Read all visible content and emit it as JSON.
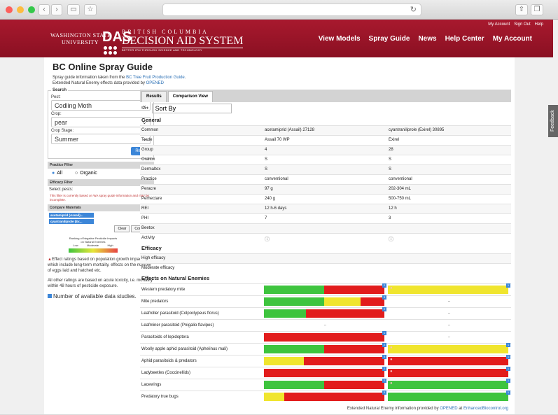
{
  "browser": {
    "nav_icons": [
      "chevron-left-icon",
      "chevron-right-icon",
      "sidebar-icon",
      "star-icon"
    ]
  },
  "header": {
    "wsu_line1": "WASHINGTON STATE",
    "wsu_line2": "UNIVERSITY",
    "das": "DAS",
    "brand_line1": "BRITISH COLUMBIA",
    "brand_line2": "DECISION AID SYSTEM",
    "brand_line3": "BETTER IPM THROUGH SCIENCE AND TECHNOLOGY",
    "top_links": [
      "My Account",
      "Sign Out",
      "Help"
    ],
    "nav": [
      "View Models",
      "Spray Guide",
      "News",
      "Help Center",
      "My Account"
    ]
  },
  "feedback": "Feedback",
  "page": {
    "title": "BC Online Spray Guide",
    "intro_line1_prefix": "Spray guide information taken from the ",
    "intro_line1_link": "BC Tree Fruit Production Guide",
    "intro_line2_prefix": "Extended Natural Enemy effects data provided by ",
    "intro_line2_link": "OPENED"
  },
  "sidebar": {
    "search_legend": "Search",
    "pest_label": "Pest:",
    "pest_value": "Codling Moth",
    "crop_label": "Crop:",
    "crop_value": "pear",
    "stage_label": "Crop Stage:",
    "stage_value": "Summer",
    "reset": "Reset",
    "practice_header": "Practice Filter",
    "practice_all": "All",
    "practice_organic": "Organic",
    "efficacy_header": "Efficacy Filter",
    "select_pests": "Select pests:",
    "efficacy_note": "This filter is currently based on WA spray guide information and may be incomplete.",
    "compare_header": "Compare Materials",
    "materials": [
      "acetamiprid (Assail)...",
      "cyantraniliprole (Ex..."
    ],
    "clear": "Clear",
    "compare": "Compare",
    "legend_title": "Ranking of Negative Pesticide Impacts on Natural Enemies",
    "legend_low": "Low",
    "legend_moderate": "Moderate",
    "legend_high": "High",
    "note1": "Effect ratings based on population growth impacts, which include long-term mortality, effects on the number of eggs laid and hatched etc.",
    "note2": "All other ratings are based on acute toxicity, i.e. mortality within 48 hours of pesticide exposure.",
    "note3": "Number of available data studies."
  },
  "content": {
    "tabs": [
      "Results",
      "Comparison View"
    ],
    "sort_label": "Sort:",
    "sort_value": "Sort By",
    "general_title": "General",
    "general_rows": [
      [
        "Common",
        "acetamiprid (Assail) 27128",
        "cyantraniliprole (Exirel) 30895"
      ],
      [
        "Trade",
        "Assail 70 WP",
        "Exirel"
      ],
      [
        "Group",
        "4",
        "28"
      ],
      [
        "Oraltox",
        "S",
        "S"
      ],
      [
        "Dermaltox",
        "S",
        "S"
      ],
      [
        "Practice",
        "conventional",
        "conventional"
      ],
      [
        "Peracre",
        "97 g",
        "202-304 mL"
      ],
      [
        "Perhectare",
        "240 g",
        "500-750 mL"
      ],
      [
        "REI",
        "12 h-6 days",
        "12 h"
      ],
      [
        "PHI",
        "7",
        "3"
      ],
      [
        "Beetox",
        "",
        ""
      ],
      [
        "Activity",
        "",
        ""
      ]
    ],
    "efficacy_title": "Efficacy",
    "efficacy_rows": [
      "High efficacy",
      "Moderate efficacy"
    ],
    "ne_title": "Effects on Natural Enemies",
    "ne_rows": [
      {
        "label": "Western predatory mite",
        "a": {
          "green": 0.5,
          "yellow": 0,
          "red": 0.5,
          "n": "2"
        },
        "b": {
          "green": 0,
          "yellow": 1,
          "red": 0,
          "n": "1",
          "warn": true
        }
      },
      {
        "label": "Mite predators",
        "a": {
          "green": 0.5,
          "yellow": 0.3,
          "red": 0.2,
          "n": "3"
        },
        "b": {
          "text": "--"
        }
      },
      {
        "label": "Leafroller parasitoid (Colpoclypeus florus)",
        "a": {
          "green": 0.35,
          "yellow": 0,
          "red": 0.65,
          "n": "2"
        },
        "b": {
          "text": "--"
        }
      },
      {
        "label": "Leafminer parasitoid (Pnigalio flavipes)",
        "a": {
          "text": "--"
        },
        "b": {
          "text": "--"
        }
      },
      {
        "label": "Parasitoids of lepidoptera",
        "a": {
          "green": 0,
          "yellow": 0,
          "red": 1,
          "n": "1"
        },
        "b": {
          "text": "--"
        }
      },
      {
        "label": "Woolly apple aphid parasitoid (Aphelinus mali)",
        "a": {
          "green": 0.5,
          "yellow": 0,
          "red": 0.5,
          "n": "2"
        },
        "b": {
          "green": 0,
          "yellow": 1,
          "red": 0,
          "n": "1",
          "warn": true
        }
      },
      {
        "label": "Aphid parasitoids & predators",
        "a": {
          "green": 0,
          "yellow": 0.33,
          "red": 0.67,
          "n": "3"
        },
        "b": {
          "green": 0,
          "yellow": 0,
          "red": 1,
          "n": "1",
          "warn": true
        }
      },
      {
        "label": "Ladybeetles (Coccinellids)",
        "a": {
          "green": 0,
          "yellow": 0,
          "red": 1,
          "n": "2"
        },
        "b": {
          "green": 0,
          "yellow": 0,
          "red": 1,
          "n": "1",
          "warn": true
        }
      },
      {
        "label": "Lacewings",
        "a": {
          "green": 0.5,
          "yellow": 0,
          "red": 0.5,
          "n": "2"
        },
        "b": {
          "green": 1,
          "yellow": 0,
          "red": 0,
          "n": "1",
          "warn": true
        }
      },
      {
        "label": "Predatory true bugs",
        "a": {
          "green": 0,
          "yellow": 0.17,
          "red": 0.83,
          "n": "3"
        },
        "b": {
          "green": 1,
          "yellow": 0,
          "red": 0,
          "n": "1"
        }
      }
    ],
    "footer_prefix": "Extended Natural Enemy information provided by ",
    "footer_link1": "OPENED",
    "footer_mid": " at ",
    "footer_link2": "EnhancedBiocontrol.org"
  },
  "colors": {
    "green": "#3ec43e",
    "yellow": "#f0e52e",
    "red": "#e21c1c",
    "header": "#9a1428",
    "accent": "#3c86d8"
  }
}
